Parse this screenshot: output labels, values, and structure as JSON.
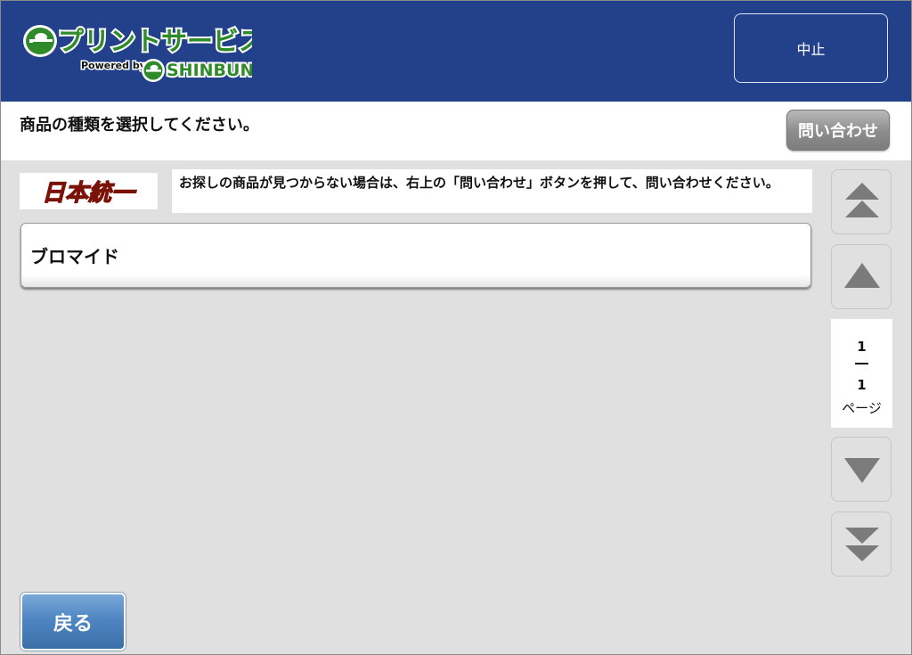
{
  "header": {
    "logo_main": "プリントサービス",
    "logo_powered": "Powered by",
    "logo_brand": "SHINBUN",
    "cancel_label": "中止"
  },
  "instruction": {
    "text": "商品の種類を選択してください。",
    "inquiry_label": "問い合わせ"
  },
  "brand": {
    "logo_text": "日本統一",
    "notice": "お探しの商品が見つからない場合は、右上の「問い合わせ」ボタンを押して、問い合わせください。"
  },
  "products": [
    {
      "label": "ブロマイド"
    }
  ],
  "pager": {
    "current": "1",
    "total": "1",
    "unit": "ページ"
  },
  "footer": {
    "back_label": "戻る"
  },
  "colors": {
    "header_bg": "#23418a",
    "logo_green": "#2f8a2a",
    "back_button": "#4f86c2",
    "arrow_gray": "#7b7b7b"
  },
  "icons": [
    "double-up-arrow-icon",
    "up-arrow-icon",
    "down-arrow-icon",
    "double-down-arrow-icon"
  ]
}
